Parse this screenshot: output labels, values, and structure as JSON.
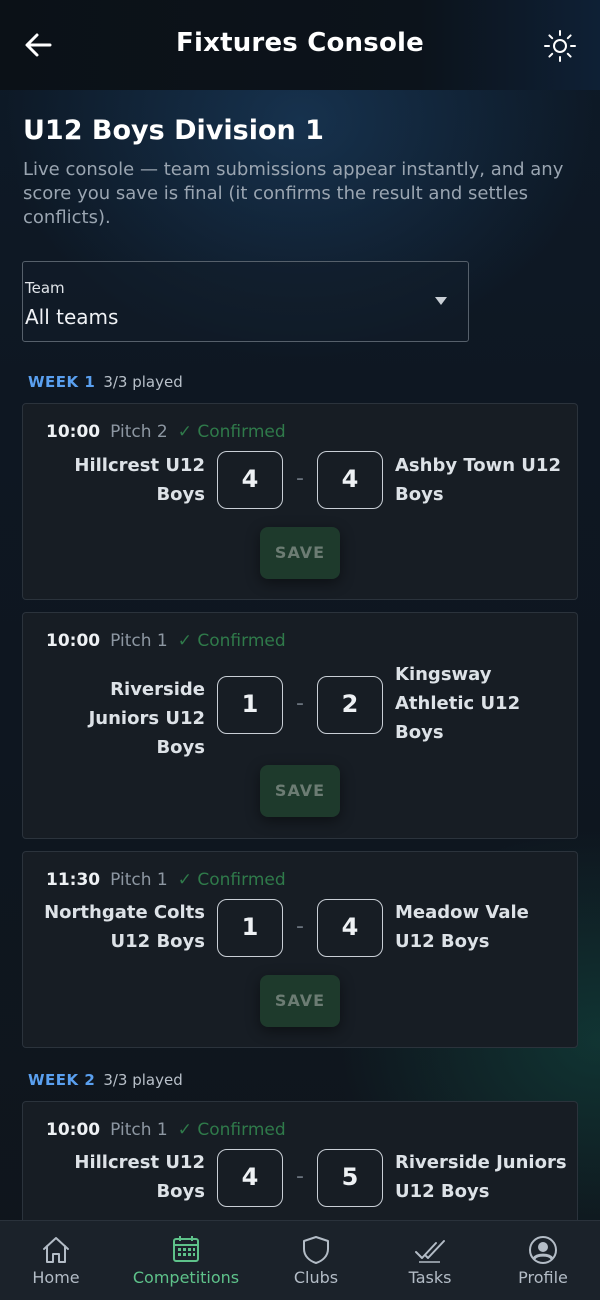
{
  "header": {
    "title": "Fixtures Console"
  },
  "intro": {
    "title": "U12 Boys Division 1",
    "description": "Live console — team submissions appear instantly, and any score you save is final (it confirms the result and settles conflicts)."
  },
  "team_filter": {
    "label": "Team",
    "value": "All teams"
  },
  "save_label": "SAVE",
  "score_separator": "-",
  "weeks": [
    {
      "label": "WEEK 1",
      "played": "3/3 played",
      "fixtures": [
        {
          "time": "10:00",
          "pitch": "Pitch 2",
          "status": "✓ Confirmed",
          "home": "Hillcrest U12 Boys",
          "away": "Ashby Town U12 Boys",
          "home_score": "4",
          "away_score": "4"
        },
        {
          "time": "10:00",
          "pitch": "Pitch 1",
          "status": "✓ Confirmed",
          "home": "Riverside Juniors U12 Boys",
          "away": "Kingsway Athletic U12 Boys",
          "home_score": "1",
          "away_score": "2"
        },
        {
          "time": "11:30",
          "pitch": "Pitch 1",
          "status": "✓ Confirmed",
          "home": "Northgate Colts U12 Boys",
          "away": "Meadow Vale U12 Boys",
          "home_score": "1",
          "away_score": "4"
        }
      ]
    },
    {
      "label": "WEEK 2",
      "played": "3/3 played",
      "fixtures": [
        {
          "time": "10:00",
          "pitch": "Pitch 1",
          "status": "✓ Confirmed",
          "home": "Hillcrest U12 Boys",
          "away": "Riverside Juniors U12 Boys",
          "home_score": "4",
          "away_score": "5"
        }
      ]
    }
  ],
  "nav": {
    "items": [
      {
        "label": "Home",
        "icon": "home-icon"
      },
      {
        "label": "Competitions",
        "icon": "calendar-icon",
        "active": true
      },
      {
        "label": "Clubs",
        "icon": "shield-icon"
      },
      {
        "label": "Tasks",
        "icon": "double-check-icon"
      },
      {
        "label": "Profile",
        "icon": "user-circle-icon"
      }
    ]
  },
  "colors": {
    "accent_green": "#5ec28a",
    "week_blue": "#5aa0f0",
    "confirmed_green": "#2f7a4a"
  }
}
